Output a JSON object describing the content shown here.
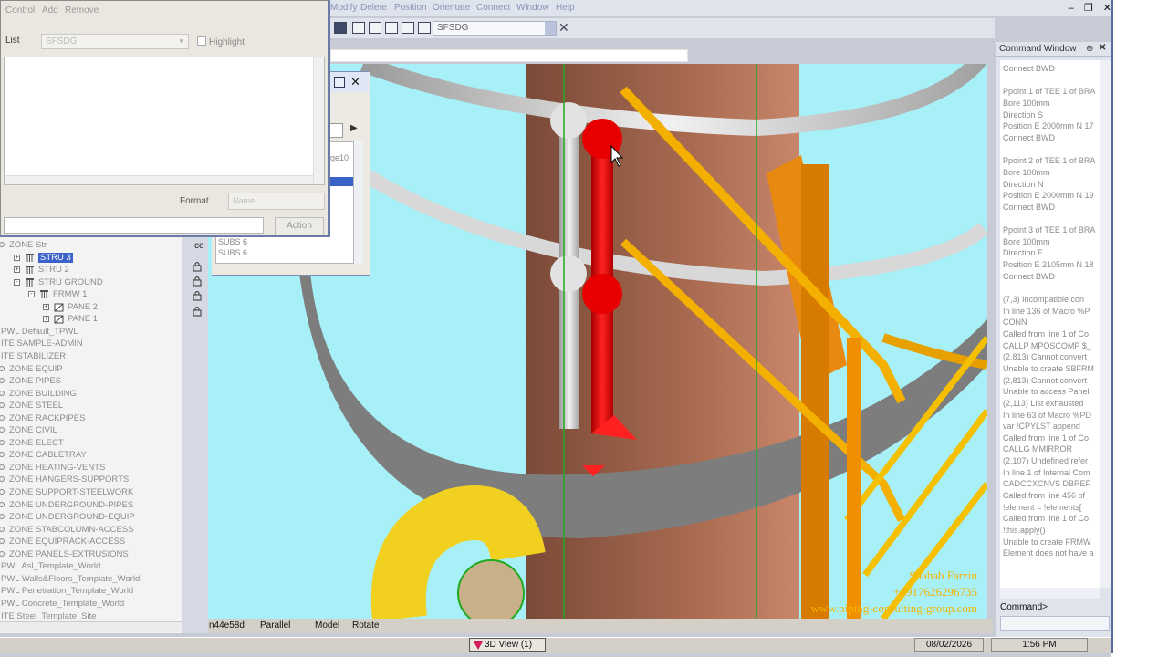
{
  "main_menu": [
    "Modify",
    "Delete",
    "Position",
    "Orientate",
    "Connect",
    "Window",
    "Help"
  ],
  "toolbar": {
    "selected_element": "SFSDG"
  },
  "dialog": {
    "menu": [
      "Control",
      "Add",
      "Remove"
    ],
    "list_label": "List",
    "list_value": "SFSDG",
    "highlight_label": "Highlight",
    "format_label": "Format",
    "format_value": "Name",
    "action_label": "Action"
  },
  "side_window": {
    "items": [
      "age10",
      "SUBS  6",
      "SUBS  6"
    ]
  },
  "tree": [
    {
      "label": "ZONE Str",
      "indent": 10,
      "kind": "zone",
      "dark": false
    },
    {
      "label": "STRU 3",
      "indent": 27,
      "kind": "stru",
      "dark": true,
      "selected": true,
      "expand": "+"
    },
    {
      "label": "STRU 2",
      "indent": 27,
      "kind": "stru",
      "dark": false,
      "expand": "+"
    },
    {
      "label": "STRU GROUND",
      "indent": 27,
      "kind": "stru",
      "dark": false,
      "expand": "-"
    },
    {
      "label": "FRMW 1",
      "indent": 43,
      "kind": "frmw",
      "dark": false,
      "expand": "-"
    },
    {
      "label": "PANE 2",
      "indent": 59,
      "kind": "pane",
      "dark": false,
      "expand": "+"
    },
    {
      "label": "PANE 1",
      "indent": 59,
      "kind": "pane",
      "dark": false,
      "expand": "+"
    },
    {
      "label": "PWL Default_TPWL",
      "indent": 1,
      "kind": "none",
      "dark": false
    },
    {
      "label": "ITE SAMPLE-ADMIN",
      "indent": 1,
      "kind": "none",
      "dark": false
    },
    {
      "label": "ITE STABILIZER",
      "indent": 1,
      "kind": "none",
      "dark": false
    },
    {
      "label": "ZONE EQUIP",
      "indent": 10,
      "kind": "zone",
      "dark": false
    },
    {
      "label": "ZONE PIPES",
      "indent": 10,
      "kind": "zone",
      "dark": false
    },
    {
      "label": "ZONE BUILDING",
      "indent": 10,
      "kind": "zone",
      "dark": false
    },
    {
      "label": "ZONE STEEL",
      "indent": 10,
      "kind": "zone",
      "dark": false
    },
    {
      "label": "ZONE RACKPIPES",
      "indent": 10,
      "kind": "zone",
      "dark": false
    },
    {
      "label": "ZONE CIVIL",
      "indent": 10,
      "kind": "zone",
      "dark": false
    },
    {
      "label": "ZONE ELECT",
      "indent": 10,
      "kind": "zone",
      "dark": false
    },
    {
      "label": "ZONE CABLETRAY",
      "indent": 10,
      "kind": "zone",
      "dark": false
    },
    {
      "label": "ZONE HEATING-VENTS",
      "indent": 10,
      "kind": "zone",
      "dark": false
    },
    {
      "label": "ZONE HANGERS-SUPPORTS",
      "indent": 10,
      "kind": "zone",
      "dark": false
    },
    {
      "label": "ZONE SUPPORT-STEELWORK",
      "indent": 10,
      "kind": "zone",
      "dark": false
    },
    {
      "label": "ZONE UNDERGROUND-PIPES",
      "indent": 10,
      "kind": "zone",
      "dark": false
    },
    {
      "label": "ZONE UNDERGROUND-EQUIP",
      "indent": 10,
      "kind": "zone",
      "dark": false
    },
    {
      "label": "ZONE STABCOLUMN-ACCESS",
      "indent": 10,
      "kind": "zone",
      "dark": false
    },
    {
      "label": "ZONE EQUIPRACK-ACCESS",
      "indent": 10,
      "kind": "zone",
      "dark": false
    },
    {
      "label": "ZONE PANELS-EXTRUSIONS",
      "indent": 10,
      "kind": "zone",
      "dark": false
    },
    {
      "label": "PWL Asl_Template_World",
      "indent": 1,
      "kind": "none",
      "dark": false
    },
    {
      "label": "PWL Walls&Floors_Template_World",
      "indent": 1,
      "kind": "none",
      "dark": false
    },
    {
      "label": "PWL Penetration_Template_World",
      "indent": 1,
      "kind": "none",
      "dark": false
    },
    {
      "label": "PWL Concrete_Template_World",
      "indent": 1,
      "kind": "none",
      "dark": false
    },
    {
      "label": "ITE Steel_Template_Site",
      "indent": 1,
      "kind": "none",
      "dark": false
    }
  ],
  "tree_strip_label": "ce",
  "status": {
    "element": "n44e58d",
    "projection": "Parallel",
    "mode": "Model",
    "action": "Rotate"
  },
  "watermark": {
    "name": "Shahab Farzin",
    "phone": "+4917626296735",
    "site": "www.piping-consulting-group.com"
  },
  "command_window": {
    "title": "Command Window",
    "lines": [
      "Connect BWD",
      "",
      "Ppoint 1 of TEE 1 of BRA",
      "Bore 100mm",
      "Direction S",
      "Position E 2000mm N 17",
      "Connect BWD",
      "",
      "Ppoint 2 of TEE 1 of BRA",
      "Bore 100mm",
      "Direction N",
      "Position E 2000mm N 19",
      "Connect BWD",
      "",
      "Ppoint 3 of TEE 1 of BRA",
      "Bore 100mm",
      "Direction E",
      "Position E 2105mm N 18",
      "Connect BWD",
      "",
      "(7,3)    Incompatible con",
      "  In line 136 of Macro %P",
      "    CONN",
      "  Called from line 1  of Co",
      "CALLP MPOSCOMP $_",
      "(2,813)   Cannot convert",
      "Unable to create SBFRM",
      "(2,813)   Cannot convert",
      "Unable to access Panel.",
      "(2,113)   List exhausted",
      "  In line 63 of Macro %PD",
      "    var !CPYLST append",
      "  Called from line 1  of Co",
      "CALLG MMIRROR",
      "(2,107)   Undefined refer",
      "  In line 1 of Internal Com",
      "CADCCXCNVS DBREF",
      "  Called from line 456 of",
      "    !element = !elements[",
      "  Called from line 1  of Co",
      "!this.apply()",
      "Unable to create FRMW",
      "Element does not have a"
    ],
    "prompt": "Command>"
  },
  "taskbar": {
    "view_label": "3D View (1)",
    "date": "08/02/2026",
    "time": "1:56 PM"
  }
}
